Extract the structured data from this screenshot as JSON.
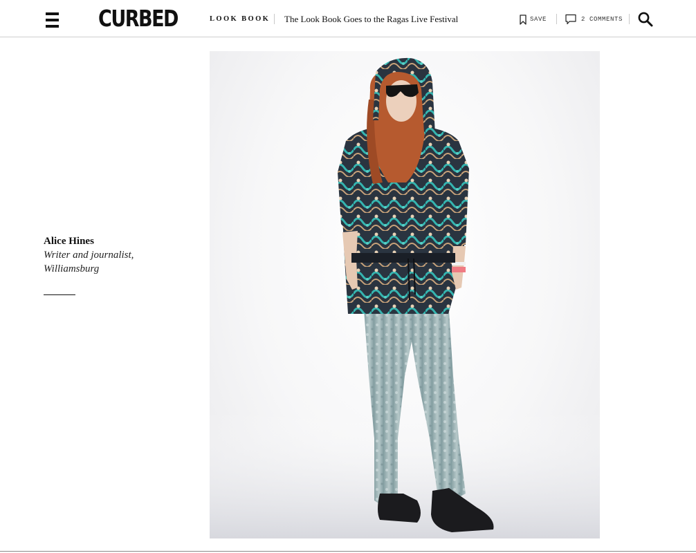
{
  "header": {
    "brand": "CURBED",
    "section": "Look Book",
    "headline": "The Look Book Goes to the Ragas Live Festival",
    "save_label": "Save",
    "comments_label": "2 Comments"
  },
  "article": {
    "subject_name": "Alice Hines",
    "subject_role": "Writer and journalist, Williamsburg"
  },
  "icons": {
    "menu": "hamburger-menu-icon",
    "save": "bookmark-icon",
    "comments": "speech-bubble-icon",
    "search": "magnifier-icon"
  }
}
